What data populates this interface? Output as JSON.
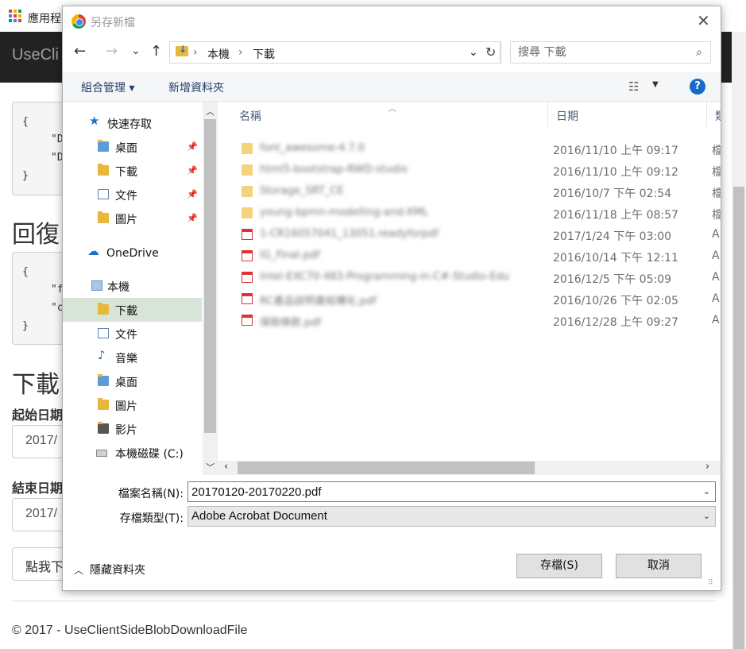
{
  "bookmarks": {
    "apps_label": "應用程"
  },
  "webpage": {
    "brand": "UseCli",
    "code1": {
      "open": "{",
      "line1": "\"D",
      "line2": "\"D",
      "close": "}"
    },
    "heading_reply": "回復",
    "code2": {
      "open": "{",
      "line1": "\"f",
      "line2": "\"c",
      "close": "}"
    },
    "heading_download": "下載",
    "start_label": "起始日期",
    "start_value": "2017/",
    "end_label": "結束日期",
    "end_value": "2017/",
    "click_button": "點我下",
    "footer": "© 2017 - UseClientSideBlobDownloadFile"
  },
  "dialog": {
    "title": "另存新檔",
    "close_glyph": "✕",
    "nav": {
      "back": "←",
      "forward": "→",
      "recent": "⌄",
      "up": "↑"
    },
    "address": {
      "segments": [
        "本機",
        "下載"
      ],
      "separator": "›"
    },
    "search_placeholder": "搜尋 下載",
    "toolbar": {
      "organize": "組合管理 ▾",
      "new_folder": "新增資料夾",
      "help": "?"
    },
    "nav_pane": [
      {
        "label": "快速存取",
        "icon": "star-icon",
        "pinned": false
      },
      {
        "label": "桌面",
        "icon": "desktop-folder-icon",
        "pinned": true
      },
      {
        "label": "下載",
        "icon": "downloads-folder-icon",
        "pinned": true
      },
      {
        "label": "文件",
        "icon": "documents-icon",
        "pinned": true
      },
      {
        "label": "圖片",
        "icon": "pictures-folder-icon",
        "pinned": true
      },
      {
        "label": "OneDrive",
        "icon": "cloud-icon",
        "pinned": false
      },
      {
        "label": "本機",
        "icon": "computer-icon",
        "pinned": false
      },
      {
        "label": "下載",
        "icon": "downloads-folder-icon",
        "pinned": false,
        "selected": true
      },
      {
        "label": "文件",
        "icon": "documents-icon",
        "pinned": false
      },
      {
        "label": "音樂",
        "icon": "music-icon",
        "pinned": false
      },
      {
        "label": "桌面",
        "icon": "desktop-folder-icon",
        "pinned": false
      },
      {
        "label": "圖片",
        "icon": "pictures-folder-icon",
        "pinned": false
      },
      {
        "label": "影片",
        "icon": "videos-folder-icon",
        "pinned": false
      },
      {
        "label": "本機磁碟 (C:)",
        "icon": "drive-icon",
        "pinned": false
      }
    ],
    "columns": {
      "name": "名稱",
      "date": "日期",
      "type": "類"
    },
    "files": [
      {
        "name": "font_awesome-4.7.0",
        "date": "2016/11/10 上午 09:17",
        "type": "檔",
        "kind": "folder"
      },
      {
        "name": "html5-bootstrap-RWD-studio",
        "date": "2016/11/10 上午 09:12",
        "type": "檔",
        "kind": "folder"
      },
      {
        "name": "Storage_SRT_CE",
        "date": "2016/10/7 下午 02:54",
        "type": "檔",
        "kind": "folder"
      },
      {
        "name": "young-bpmn-modelling-and-XML",
        "date": "2016/11/18 上午 08:57",
        "type": "檔",
        "kind": "folder"
      },
      {
        "name": "1-CR16057041_13051.readyforpdf",
        "date": "2017/1/24 下午 03:00",
        "type": "A",
        "kind": "pdf"
      },
      {
        "name": "IG_Final.pdf",
        "date": "2016/10/14 下午 12:11",
        "type": "A",
        "kind": "pdf"
      },
      {
        "name": "Intel-EXC70-483-Programming-in-C#-Studio-Edu",
        "date": "2016/12/5 下午 05:09",
        "type": "A",
        "kind": "pdf"
      },
      {
        "name": "RC產品說明書結構化.pdf",
        "date": "2016/10/26 下午 02:05",
        "type": "A",
        "kind": "pdf"
      },
      {
        "name": "保險條款.pdf",
        "date": "2016/12/28 上午 09:27",
        "type": "A",
        "kind": "pdf"
      }
    ],
    "filename_label": "檔案名稱(N):",
    "filename_value": "20170120-20170220.pdf",
    "filetype_label": "存檔類型(T):",
    "filetype_value": "Adobe Acrobat Document",
    "hide_folders": "隱藏資料夾",
    "save_button": "存檔(S)",
    "cancel_button": "取消"
  }
}
